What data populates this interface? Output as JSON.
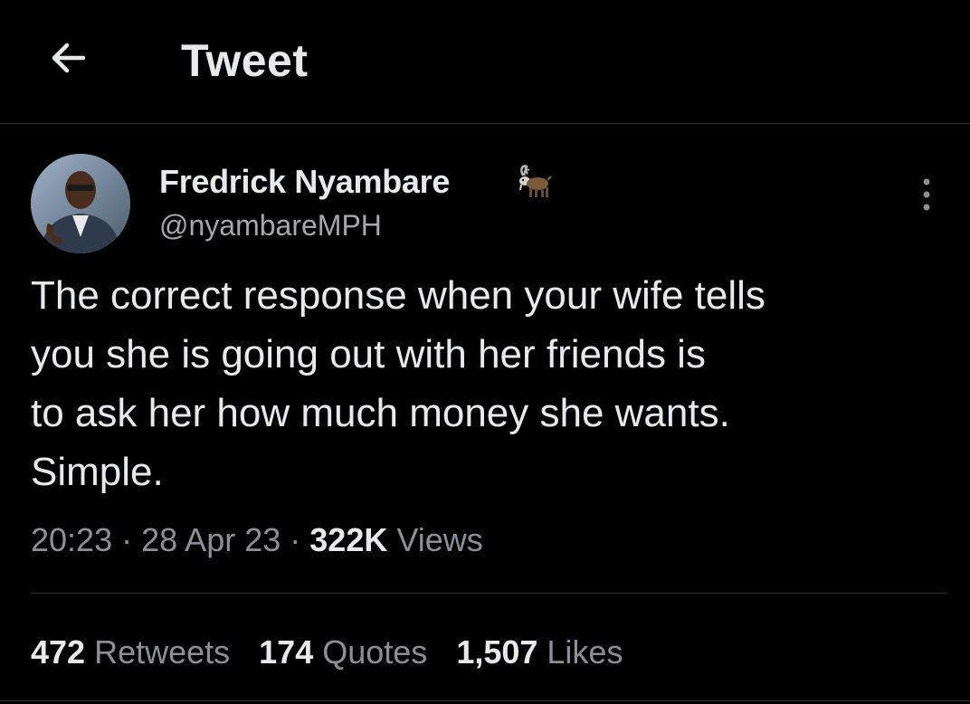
{
  "header": {
    "title": "Tweet",
    "back_icon": "arrow-left-icon"
  },
  "author": {
    "display_name": "Fredrick Nyambare",
    "handle": "@nyambareMPH",
    "badge_icon": "goat-emoji-icon"
  },
  "tweet": {
    "text": "The correct response when your wife tells\nyou she is going out with her friends is\nto ask her how much money she wants.\nSimple.",
    "time": "20:23",
    "date": "28 Apr 23",
    "separator": "·",
    "views_count": "322K",
    "views_label": "Views"
  },
  "stats": [
    {
      "count": "472",
      "label": "Retweets"
    },
    {
      "count": "174",
      "label": "Quotes"
    },
    {
      "count": "1,507",
      "label": "Likes"
    }
  ],
  "colors": {
    "background": "#000000",
    "primary_text": "#e7e9ea",
    "secondary_text": "#8b9096",
    "border": "#2f3336"
  }
}
